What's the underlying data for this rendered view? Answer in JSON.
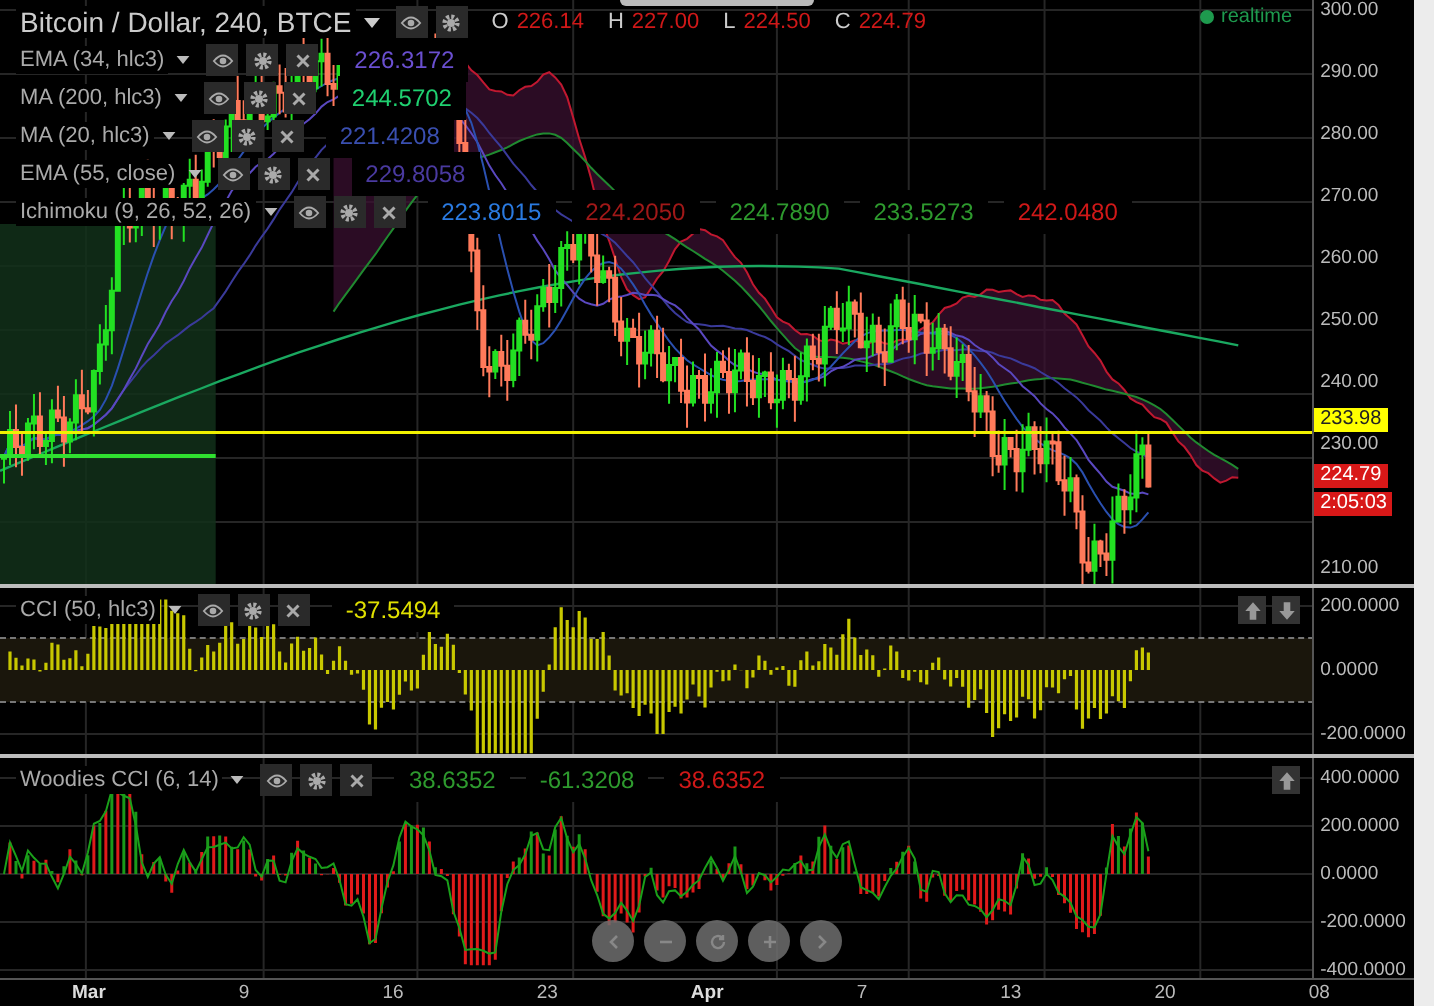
{
  "main_chart": {
    "title": "Bitcoin / Dollar, 240, BTCE",
    "ohlc": [
      {
        "label": "O",
        "value": "226.14"
      },
      {
        "label": "H",
        "value": "227.00"
      },
      {
        "label": "L",
        "value": "224.50"
      },
      {
        "label": "C",
        "value": "224.79"
      }
    ],
    "indicators": [
      {
        "name": "EMA (34, hlc3)",
        "values": [
          {
            "text": "226.3172",
            "color": "#6a4fd0"
          }
        ]
      },
      {
        "name": "MA (200, hlc3)",
        "values": [
          {
            "text": "244.5702",
            "color": "#1fd070"
          }
        ]
      },
      {
        "name": "MA (20, hlc3)",
        "values": [
          {
            "text": "221.4208",
            "color": "#3a4fb0"
          }
        ]
      },
      {
        "name": "EMA (55, close)",
        "values": [
          {
            "text": "229.8058",
            "color": "#4a3aa0"
          }
        ]
      },
      {
        "name": "Ichimoku (9, 26, 52, 26)",
        "values": [
          {
            "text": "223.8015",
            "color": "#2a7ae0"
          },
          {
            "text": "224.2050",
            "color": "#a01818"
          },
          {
            "text": "224.7890",
            "color": "#2e9a2e"
          },
          {
            "text": "233.5273",
            "color": "#2e9a2e"
          },
          {
            "text": "242.0480",
            "color": "#d01818"
          }
        ]
      }
    ],
    "status": "realtime",
    "y_ticks": [
      "300.00",
      "290.00",
      "280.00",
      "270.00",
      "260.00",
      "250.00",
      "240.00",
      "230.00",
      "210.00"
    ],
    "price_markers": [
      {
        "text": "233.98",
        "color": "#ffff00"
      },
      {
        "text": "224.79",
        "color": "#d81818"
      },
      {
        "text": "2:05:03",
        "color": "#d81818"
      }
    ]
  },
  "cci_pane": {
    "name": "CCI (50, hlc3)",
    "values": [
      {
        "text": "-37.5494",
        "color": "#e0e000"
      }
    ],
    "y_ticks": [
      "200.0000",
      "0.0000",
      "-200.0000"
    ]
  },
  "woodies_pane": {
    "name": "Woodies CCI (6, 14)",
    "values": [
      {
        "text": "38.6352",
        "color": "#2e9a2e"
      },
      {
        "text": "-61.3208",
        "color": "#2e9a2e"
      },
      {
        "text": "38.6352",
        "color": "#d01818"
      }
    ],
    "y_ticks": [
      "400.0000",
      "200.0000",
      "0.0000",
      "-200.0000",
      "-400.0000"
    ]
  },
  "x_axis": [
    {
      "label": "Mar",
      "kind": "month"
    },
    {
      "label": "9",
      "kind": "day"
    },
    {
      "label": "16",
      "kind": "day"
    },
    {
      "label": "23",
      "kind": "day"
    },
    {
      "label": "Apr",
      "kind": "month"
    },
    {
      "label": "7",
      "kind": "day"
    },
    {
      "label": "13",
      "kind": "day"
    },
    {
      "label": "20",
      "kind": "day"
    },
    {
      "label": "08",
      "kind": "day"
    }
  ]
}
